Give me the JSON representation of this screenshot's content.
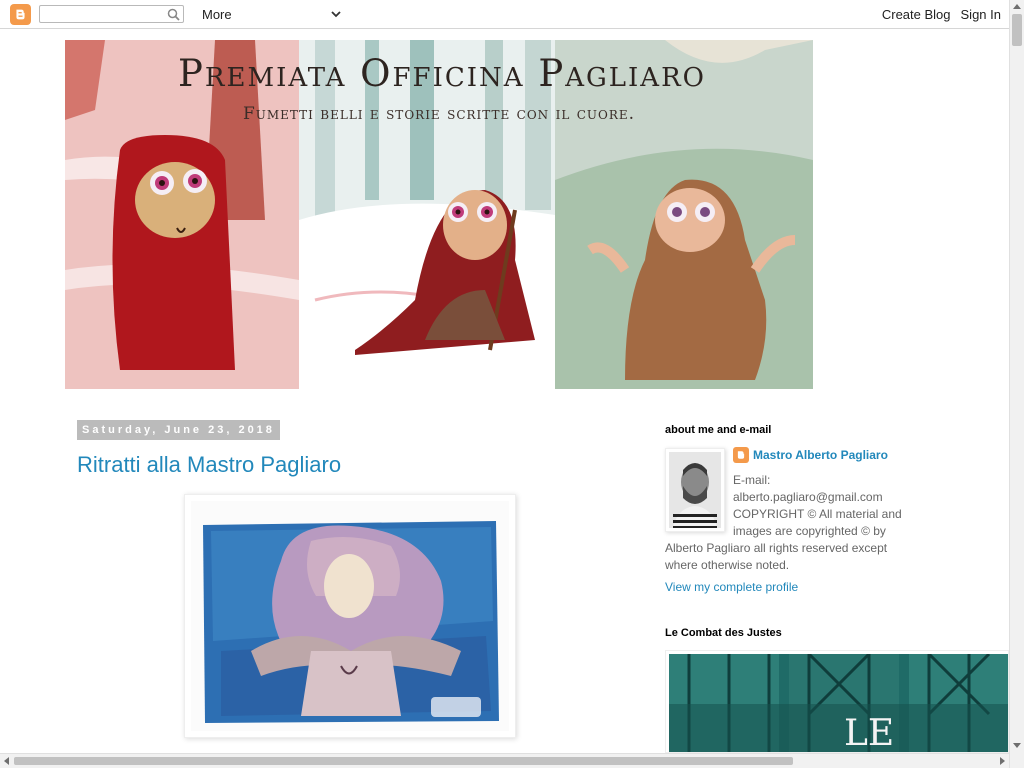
{
  "navbar": {
    "search_placeholder": "",
    "more_label": "More",
    "create_blog_label": "Create Blog",
    "sign_in_label": "Sign In"
  },
  "header": {
    "title": "Premiata  Officina Pagliaro",
    "tagline": "Fumetti belli e storie scritte con il cuore."
  },
  "post": {
    "date": "Saturday, June 23, 2018",
    "title": "Ritratti alla Mastro Pagliaro"
  },
  "sidebar": {
    "about": {
      "title": "about me and e-mail",
      "name": "Mastro Alberto Pagliaro",
      "text_lines": [
        "E-mail:",
        "alberto.pagliaro@gmail.com",
        "COPYRIGHT © All material and",
        "images are copyrighted © by",
        "Alberto Pagliaro all rights reserved except",
        "where otherwise noted."
      ],
      "profile_link": "View my complete profile"
    },
    "combat": {
      "title": "Le Combat des Justes",
      "image_text": "LE"
    }
  },
  "colors": {
    "link": "#2288bb",
    "date_bg": "#bbbbbb",
    "blogger_orange": "#f49a4b"
  }
}
